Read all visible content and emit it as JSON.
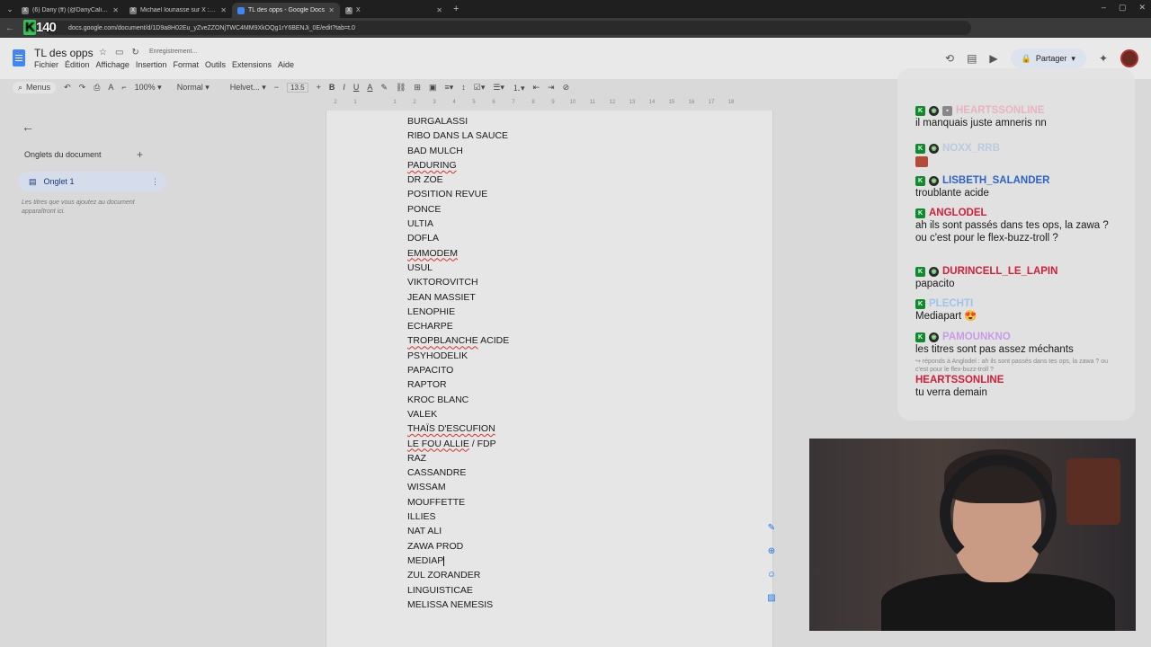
{
  "browser": {
    "tabs": [
      {
        "label": "(6) Dany (ff) (@DanyCaligula)",
        "icon": "x-logo",
        "active": false
      },
      {
        "label": "Michael Iounasse sur X : \"Le s...",
        "icon": "x-logo",
        "active": false
      },
      {
        "label": "TL des opps - Google Docs",
        "icon": "docs-logo",
        "active": true
      },
      {
        "label": "X",
        "icon": "x-logo",
        "active": false
      }
    ],
    "url": "docs.google.com/document/d/1D9a8H02Eu_yZveZZONjTWC4MM9XkOQg1rY6BENJi_0E/edit?tab=t.0",
    "overlay_logo": {
      "k": "K",
      "num": "140"
    }
  },
  "docs": {
    "title": "TL des opps",
    "saving_status": "Enregistrement...",
    "menu": [
      "Fichier",
      "Édition",
      "Affichage",
      "Insertion",
      "Format",
      "Outils",
      "Extensions",
      "Aide"
    ],
    "share_label": "Partager",
    "toolbar": {
      "search": "Menus",
      "zoom": "100%",
      "style": "Normal",
      "font": "Helvet...",
      "font_size": "13.5"
    },
    "ruler": [
      "2",
      "1",
      "",
      "1",
      "2",
      "3",
      "4",
      "5",
      "6",
      "7",
      "8",
      "9",
      "10",
      "11",
      "12",
      "13",
      "14",
      "15",
      "16",
      "17",
      "18"
    ],
    "sidebar": {
      "heading": "Onglets du document",
      "tab_label": "Onglet 1",
      "hint": "Les titres que vous ajoutez au document apparaîtront ici."
    },
    "lines": [
      {
        "text": "BURGALASSI"
      },
      {
        "text": "RIBO DANS LA SAUCE"
      },
      {
        "text": "BAD MULCH"
      },
      {
        "text": "PADURING",
        "spell": true
      },
      {
        "text": "DR ZOE"
      },
      {
        "text": "POSITION REVUE"
      },
      {
        "text": "PONCE"
      },
      {
        "text": "ULTIA"
      },
      {
        "text": "DOFLA"
      },
      {
        "text": "EMMODEM",
        "spell": true
      },
      {
        "text": "USUL"
      },
      {
        "text": "VIKTOROVITCH"
      },
      {
        "text": "JEAN MASSIET"
      },
      {
        "text": "LENOPHIE"
      },
      {
        "text": "ECHARPE"
      },
      {
        "text": "TROPBLANCHE ACIDE",
        "spell_part": "TROPBLANCHE",
        "rest": " ACIDE"
      },
      {
        "text": "PSYHODELIK"
      },
      {
        "text": "PAPACITO"
      },
      {
        "text": "RAPTOR"
      },
      {
        "text": "KROC BLANC"
      },
      {
        "text": "VALEK"
      },
      {
        "text": "THAÏS D'ESCUFION",
        "spell": true
      },
      {
        "text": "LE FOU ALLIE / FDP",
        "spell_part": "LE FOU ALLIE",
        "rest": " / FDP"
      },
      {
        "text": "RAZ"
      },
      {
        "text": "CASSANDRE"
      },
      {
        "text": "WISSAM"
      },
      {
        "text": "MOUFFETTE"
      },
      {
        "text": "ILLIES"
      },
      {
        "text": "NAT ALI"
      },
      {
        "text": "ZAWA PROD"
      },
      {
        "text": "MEDIAP",
        "cursor": true
      },
      {
        "text": "ZUL ZORANDER"
      },
      {
        "text": "LINGUISTICAE"
      },
      {
        "text": "MELISSA NEMESIS"
      }
    ]
  },
  "chat": {
    "messages": [
      {
        "user": "HEARTSSONLINE",
        "color": "#e8b4c0",
        "text": "il manquais juste amneris nn",
        "badges": [
          "k",
          "alien",
          "mod"
        ]
      },
      {
        "user": "NOXX_RRB",
        "color": "#b9cbe0",
        "text": "",
        "badges": [
          "k",
          "alien"
        ],
        "emote": true
      },
      {
        "user": "LISBETH_SALANDER",
        "color": "#2f62c9",
        "text": "troublante acide",
        "badges": [
          "k",
          "alien"
        ]
      },
      {
        "user": "ANGLODEL",
        "color": "#d0203a",
        "text": "ah ils sont passés dans tes ops, la zawa ? ou c'est pour le flex-buzz-troll ?",
        "badges": [
          "k"
        ]
      },
      {
        "user": "DURINCELL_LE_LAPIN",
        "color": "#d0203a",
        "text": "papacito",
        "badges": [
          "k",
          "alien"
        ]
      },
      {
        "user": "PLECHTI",
        "color": "#9fc3f0",
        "text": "Mediapart 😍",
        "badges": [
          "k"
        ]
      },
      {
        "user": "PAMOUNKNO",
        "color": "#c79be8",
        "text": "les titres sont pas assez méchants",
        "badges": [
          "k",
          "alien"
        ]
      },
      {
        "user": "HEARTSSONLINE",
        "color": "#d0203a",
        "text": "tu verra demain",
        "badges": [],
        "reply": "↪ réponds à Anglodel : ah ils sont passés dans tes ops, la zawa ? ou c'est pour le flex-buzz-troll ?"
      }
    ]
  }
}
